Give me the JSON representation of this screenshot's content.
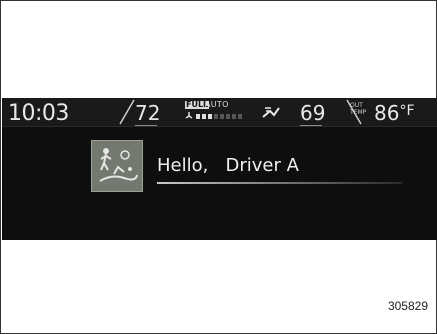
{
  "status_bar": {
    "time": "10:03",
    "driver_temp": "72",
    "fan_label": "FULL",
    "auto_label": "AUTO",
    "fan_level": 0.4,
    "passenger_temp": "69",
    "outside_label_line1": "OUT",
    "outside_label_line2": "TEMP",
    "outside_temp": "86",
    "outside_unit": "°F"
  },
  "greeting": {
    "text": "Hello,   Driver A"
  },
  "figure_code": "305829"
}
